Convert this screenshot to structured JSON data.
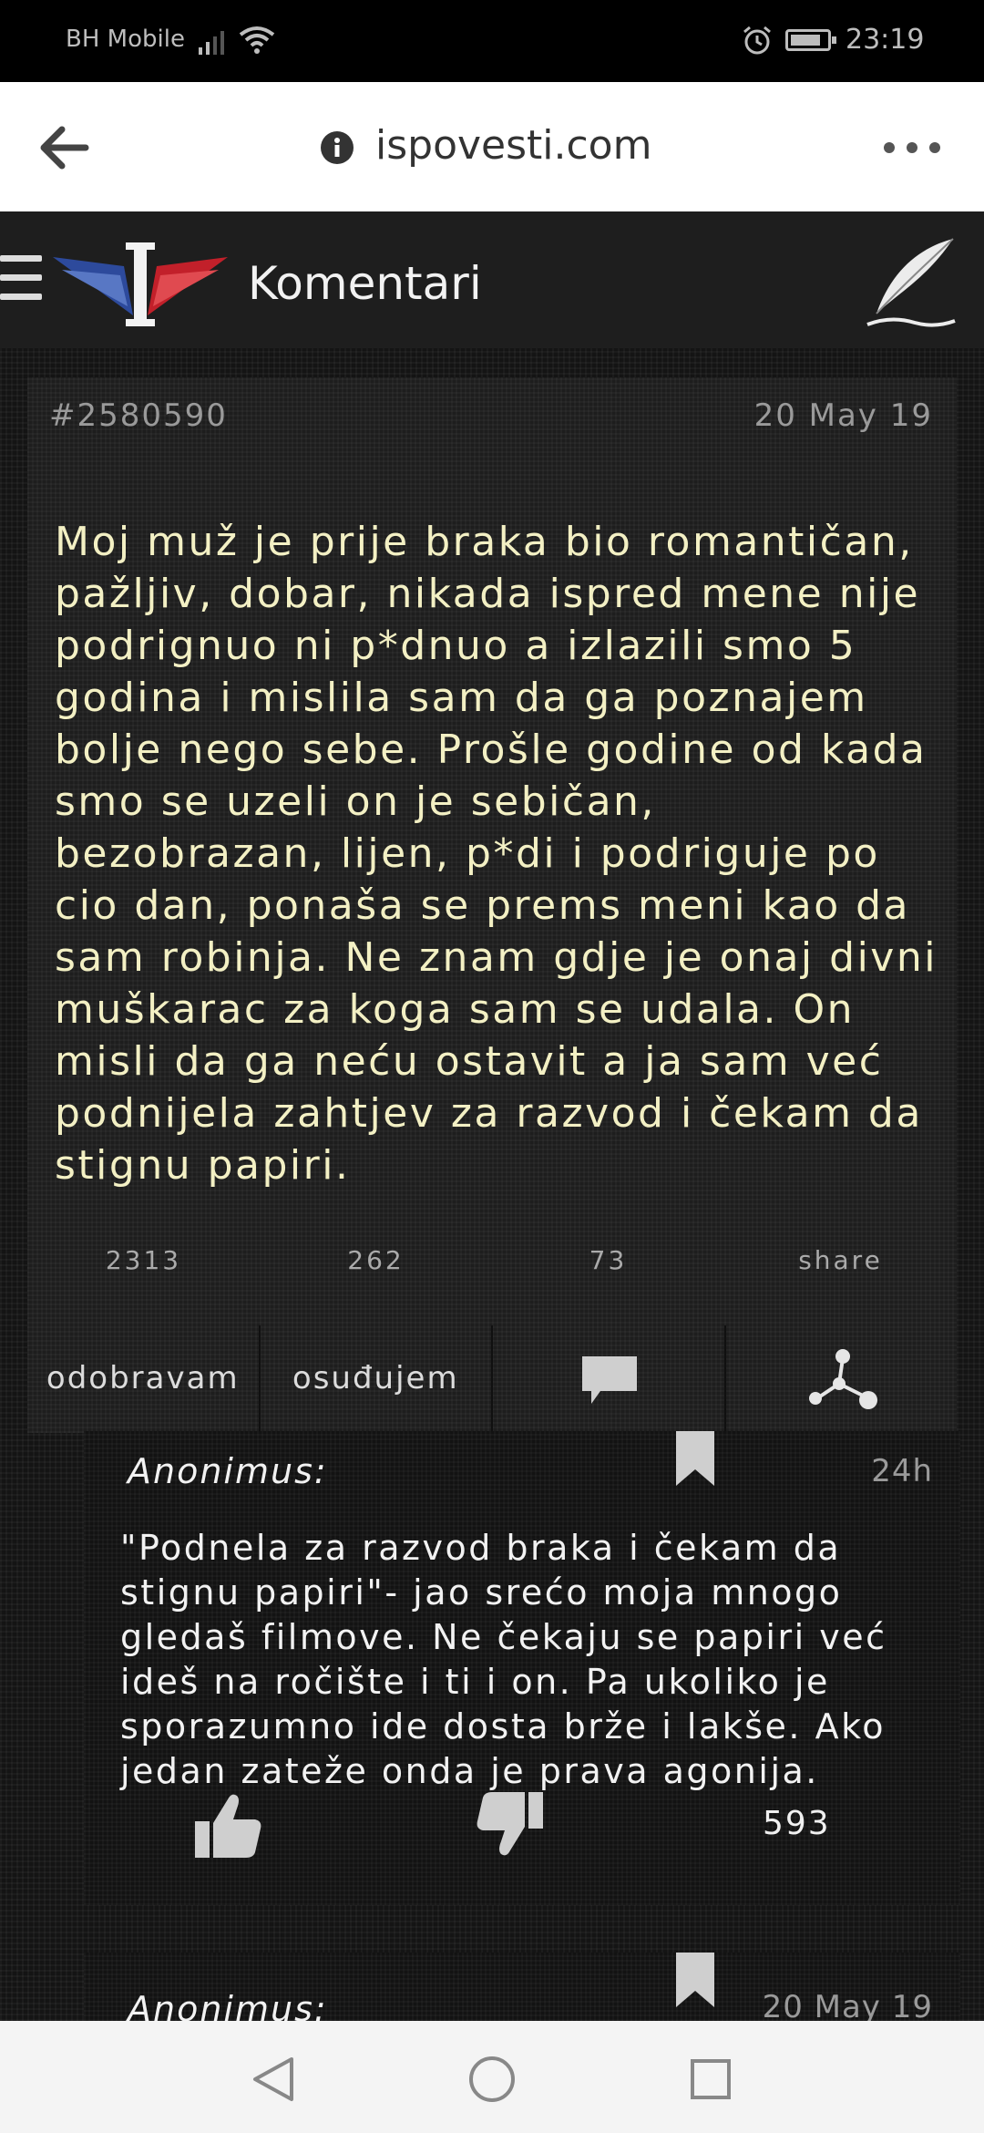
{
  "status_bar": {
    "carrier": "BH Mobile",
    "time": "23:19"
  },
  "browser": {
    "url": "ispovesti.com"
  },
  "header": {
    "title": "Komentari"
  },
  "post": {
    "id": "#2580590",
    "date": "20 May 19",
    "text": "Moj muž je prije braka bio romantičan, pažljiv, dobar, nikada ispred mene nije podrignuo ni p*dnuo a izlazili smo 5 godina i mislila sam da ga poznajem bolje nego sebe. Prošle godine od kada smo se uzeli on je sebičan, bezobrazan, lijen, p*di i podriguje po cio dan, ponaša se prems meni kao da sam robinja. Ne znam gdje je onaj divni muškarac za koga sam se udala. On misli da ga neću ostavit a ja sam već podnijela zahtjev za razvod i čekam da stignu papiri.",
    "approve_count": "2313",
    "condemn_count": "262",
    "comment_count": "73",
    "share_label": "share",
    "approve_label": "odobravam",
    "condemn_label": "osuđujem"
  },
  "comments": [
    {
      "author": "Anonimus:",
      "time": "24h",
      "text": "\"Podnela za razvod braka i čekam da stignu papiri\"- jao srećo moja mnogo gledaš filmove. Ne čekaju se papiri već ideš na ročište i ti i on. Pa ukoliko je sporazumno ide dosta brže i lakše. Ako jedan zateže onda je prava agonija.",
      "score": "593"
    },
    {
      "author": "Anonimus:",
      "time": "20 May 19"
    }
  ]
}
